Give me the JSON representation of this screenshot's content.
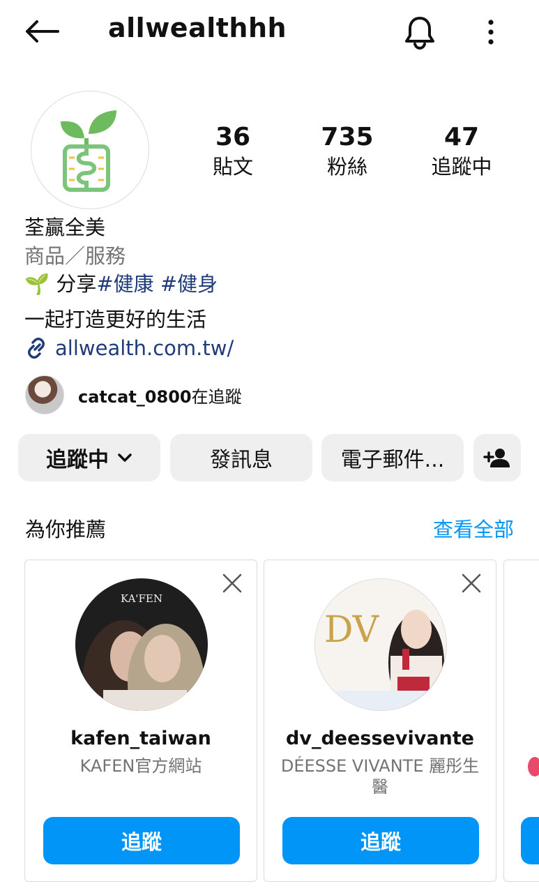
{
  "header": {
    "username": "allwealthhh",
    "icons": {
      "back": "arrow-left-icon",
      "bell": "bell-icon",
      "more": "more-vertical-icon"
    }
  },
  "profile": {
    "stats": [
      {
        "value": "36",
        "label": "貼文"
      },
      {
        "value": "735",
        "label": "粉絲"
      },
      {
        "value": "47",
        "label": "追蹤中"
      }
    ],
    "name": "荃贏全美",
    "category": "商品／服務",
    "bio_prefix": "🌱 分享",
    "hashtag_health": "#健康",
    "hashtag_fitness": "#健身",
    "bio_line2": "一起打造更好的生活",
    "website": "allwealth.com.tw/"
  },
  "mutual": {
    "username": "catcat_0800",
    "suffix": "在追蹤"
  },
  "actions": {
    "following": "追蹤中",
    "message": "發訊息",
    "email": "電子郵件..."
  },
  "suggestions": {
    "title": "為你推薦",
    "see_all": "查看全部",
    "cards": [
      {
        "username": "kafen_taiwan",
        "name": "KAFEN官方網站",
        "button": "追蹤",
        "pic_text": "KA'FEN"
      },
      {
        "username": "dv_deessevivante",
        "name": "DÉESSE VIVANTE 麗彤生醫",
        "button": "追蹤",
        "pic_text": "DV"
      }
    ]
  },
  "colors": {
    "accent": "#0095f6",
    "link": "#1f3b7a",
    "muted": "#737373",
    "button_gray": "#efefef"
  }
}
